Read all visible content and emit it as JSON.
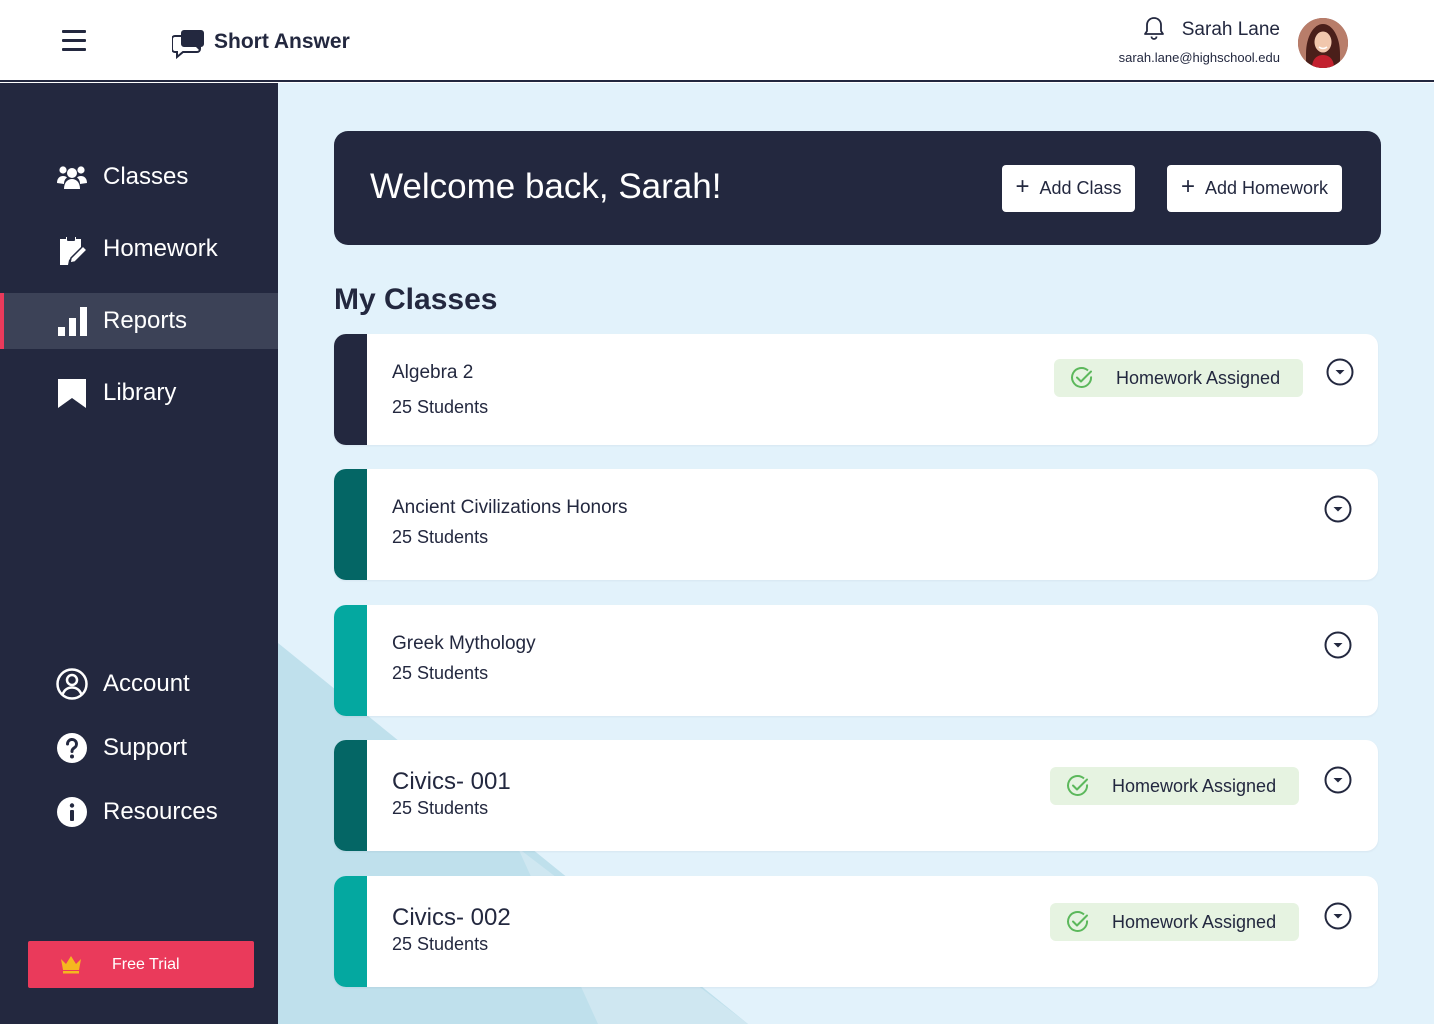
{
  "header": {
    "brand_name": "Short Answer",
    "user_name": "Sarah Lane",
    "user_email": "sarah.lane@highschool.edu",
    "icons": {
      "menu": "hamburger-menu-icon",
      "brand": "chat-bubbles-icon",
      "notifications": "bell-icon"
    }
  },
  "sidebar": {
    "items": [
      {
        "label": "Classes",
        "icon": "people-icon",
        "active": false
      },
      {
        "label": "Homework",
        "icon": "clipboard-edit-icon",
        "active": false
      },
      {
        "label": "Reports",
        "icon": "bar-chart-icon",
        "active": true
      },
      {
        "label": "Library",
        "icon": "bookmark-icon",
        "active": false
      }
    ],
    "secondary_items": [
      {
        "label": "Account",
        "icon": "user-circle-icon"
      },
      {
        "label": "Support",
        "icon": "question-circle-icon"
      },
      {
        "label": "Resources",
        "icon": "info-circle-icon"
      }
    ],
    "free_trial_label": "Free Trial"
  },
  "main": {
    "welcome_title": "Welcome back, Sarah!",
    "add_class_label": "Add Class",
    "add_homework_label": "Add Homework",
    "section_title": "My Classes",
    "classes": [
      {
        "name": "Algebra 2",
        "students": "25 Students",
        "badge": "Homework Assigned",
        "stripe_color": "#23283f"
      },
      {
        "name": "Ancient Civilizations Honors",
        "students": "25 Students",
        "badge": null,
        "stripe_color": "#046665"
      },
      {
        "name": "Greek Mythology",
        "students": "25 Students",
        "badge": null,
        "stripe_color": "#04a8a0"
      },
      {
        "name": "Civics- 001",
        "students": "25 Students",
        "badge": "Homework Assigned",
        "stripe_color": "#046665"
      },
      {
        "name": "Civics- 002",
        "students": "25 Students",
        "badge": "Homework Assigned",
        "stripe_color": "#04a8a0"
      }
    ]
  },
  "colors": {
    "navy": "#23283f",
    "accent_pink": "#ea3a5b",
    "main_bg": "#e2f2fb",
    "badge_bg": "#e6f3e1",
    "check_green": "#5cb85c",
    "crown_gold": "#f5b71f"
  }
}
